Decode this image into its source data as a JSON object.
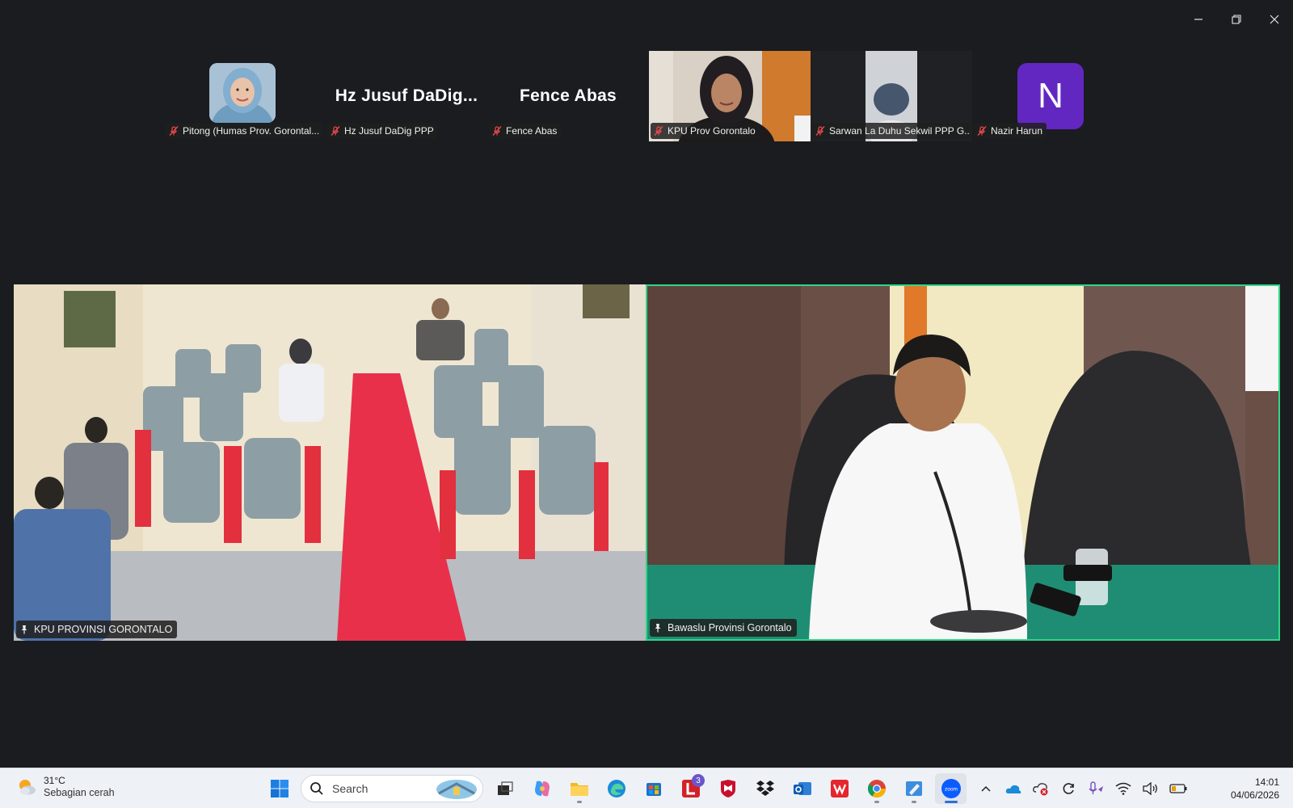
{
  "window": {
    "controls": [
      "minimize",
      "restore",
      "close"
    ]
  },
  "thumbnails": [
    {
      "id": "pitong",
      "display_name": "",
      "label": "Pitong (Humas Prov. Gorontal...",
      "mic_muted": true,
      "kind": "photo-avatar"
    },
    {
      "id": "jusuf",
      "display_name": "Hz Jusuf DaDig...",
      "label": "Hz Jusuf DaDig PPP",
      "mic_muted": true,
      "kind": "name"
    },
    {
      "id": "fence",
      "display_name": "Fence Abas",
      "label": "Fence Abas",
      "mic_muted": true,
      "kind": "name"
    },
    {
      "id": "kpu-prov",
      "display_name": "",
      "label": "KPU Prov Gorontalo",
      "mic_muted": true,
      "kind": "video"
    },
    {
      "id": "sarwan",
      "display_name": "",
      "label": "Sarwan La Duhu Sekwil PPP G...",
      "mic_muted": true,
      "kind": "video"
    },
    {
      "id": "nazir",
      "display_name": "N",
      "label": "Nazir Harun",
      "mic_muted": true,
      "kind": "letter-avatar"
    }
  ],
  "main_videos": [
    {
      "id": "left",
      "label": "KPU PROVINSI GORONTALO",
      "pinned": true,
      "active_speaker": false
    },
    {
      "id": "right",
      "label": "Bawaslu Provinsi Gorontalo",
      "pinned": true,
      "active_speaker": true
    }
  ],
  "colors": {
    "background": "#1a1c20",
    "active_speaker_border": "#2fd687",
    "avatar_purple": "#6327c1"
  },
  "taskbar": {
    "weather": {
      "temp": "31°C",
      "desc": "Sebagian cerah"
    },
    "search_placeholder": "Search",
    "apps": [
      {
        "name": "start-icon"
      },
      {
        "name": "search"
      },
      {
        "name": "task-view-icon"
      },
      {
        "name": "copilot-icon"
      },
      {
        "name": "file-explorer-icon"
      },
      {
        "name": "edge-icon"
      },
      {
        "name": "microsoft-store-icon"
      },
      {
        "name": "l-app-icon",
        "badge": "3"
      },
      {
        "name": "mcafee-icon"
      },
      {
        "name": "dropbox-icon"
      },
      {
        "name": "outlook-icon"
      },
      {
        "name": "wps-icon"
      },
      {
        "name": "chrome-icon"
      },
      {
        "name": "paint-icon"
      },
      {
        "name": "zoom-icon"
      }
    ],
    "clock": {
      "time": "14:01",
      "date": "04/06/2026"
    }
  }
}
